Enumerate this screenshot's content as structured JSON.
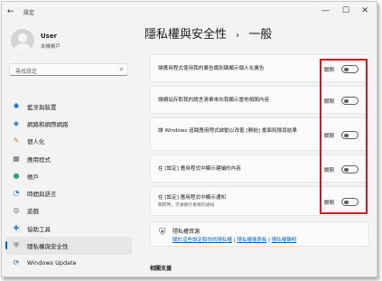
{
  "window": {
    "title": "設定",
    "back_icon": "←",
    "minimize": "—",
    "maximize": "☐",
    "close": "✕"
  },
  "user": {
    "name": "User",
    "subtitle": "本機帳戶"
  },
  "search": {
    "placeholder": "尋找設定"
  },
  "sidebar": {
    "items": [
      {
        "label": "藍牙與裝置",
        "icon": "bluetooth-icon",
        "glyph": "✱",
        "color": "#0067c0"
      },
      {
        "label": "網路和網際網路",
        "icon": "wifi-icon",
        "glyph": "◆",
        "color": "#3b8ed3"
      },
      {
        "label": "個人化",
        "icon": "brush-icon",
        "glyph": "✎",
        "color": "#d97e2a"
      },
      {
        "label": "應用程式",
        "icon": "apps-icon",
        "glyph": "▦",
        "color": "#5a6b7b"
      },
      {
        "label": "帳戶",
        "icon": "account-icon",
        "glyph": "●",
        "color": "#2fa36b"
      },
      {
        "label": "時間與語言",
        "icon": "globe-clock-icon",
        "glyph": "◔",
        "color": "#2a7bd4"
      },
      {
        "label": "遊戲",
        "icon": "gamepad-icon",
        "glyph": "◎",
        "color": "#6a6a6a"
      },
      {
        "label": "協助工具",
        "icon": "accessibility-icon",
        "glyph": "✚",
        "color": "#2a7bd4"
      },
      {
        "label": "隱私權與安全性",
        "icon": "shield-icon",
        "glyph": "⛨",
        "color": "#666666",
        "active": true
      },
      {
        "label": "Windows Update",
        "icon": "windows-update-icon",
        "glyph": "⟳",
        "color": "#0067c0"
      }
    ]
  },
  "breadcrumb": {
    "parent": "隱私權與安全性",
    "separator": "›",
    "current": "一般"
  },
  "settings": [
    {
      "text": "讓應用程式使用我的廣告識別碼顯示個人化廣告",
      "state": "關閉"
    },
    {
      "text": "讓網站存取我的語言清單來向我顯示當地相關內容",
      "state": "關閉"
    },
    {
      "text": "讓 Windows 追蹤應用程式啟動以改善 [開始] 畫面和搜尋結果",
      "state": "關閉"
    },
    {
      "text": "在 [設定] 應用程式中顯示建議的內容",
      "state": "關閉"
    },
    {
      "text": "在 [設定] 應用程式中顯示通知",
      "sub": "關閉時，仍會顯示重要的通知",
      "state": "關閉"
    }
  ],
  "resources": {
    "title": "隱私權資源",
    "links": [
      "關於這些設定和你的隱私權",
      "隱私權儀表板",
      "隱私權聲明"
    ],
    "separator": " | "
  },
  "related": {
    "title": "相關支援"
  },
  "colors": {
    "accent": "#0067c0",
    "highlight_border": "#cc1b24"
  }
}
